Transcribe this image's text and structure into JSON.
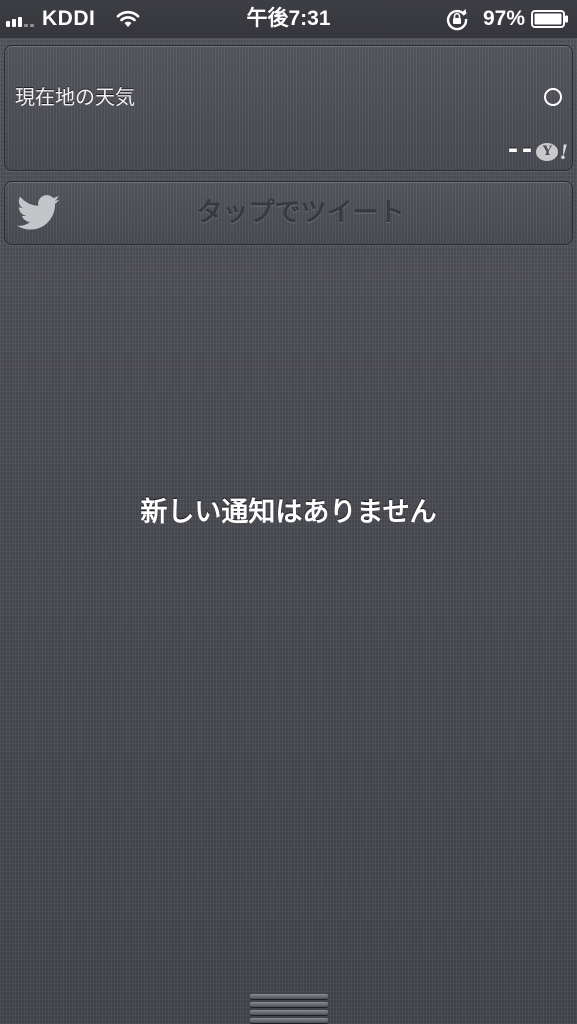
{
  "status_bar": {
    "carrier": "KDDI",
    "time": "午後7:31",
    "battery_percent": "97%",
    "signal_bars": 5,
    "signal_strength_active": 3,
    "icons": [
      "signal-icon",
      "wifi-icon",
      "rotation-lock-icon",
      "battery-icon"
    ]
  },
  "weather_widget": {
    "title": "現在地の天気",
    "temperature": "--",
    "icons": [
      "degree-icon",
      "yahoo-logo-icon"
    ],
    "yahoo_logo_text": "Y!"
  },
  "tweet_widget": {
    "label": "タップでツイート",
    "icons": [
      "twitter-bird-icon"
    ]
  },
  "notifications": {
    "empty_message": "新しい通知はありません"
  },
  "colors": {
    "background": "#4a4b52",
    "status_bar": "#3a3b40",
    "tweet_label": "#38393e",
    "text": "#ffffff"
  }
}
